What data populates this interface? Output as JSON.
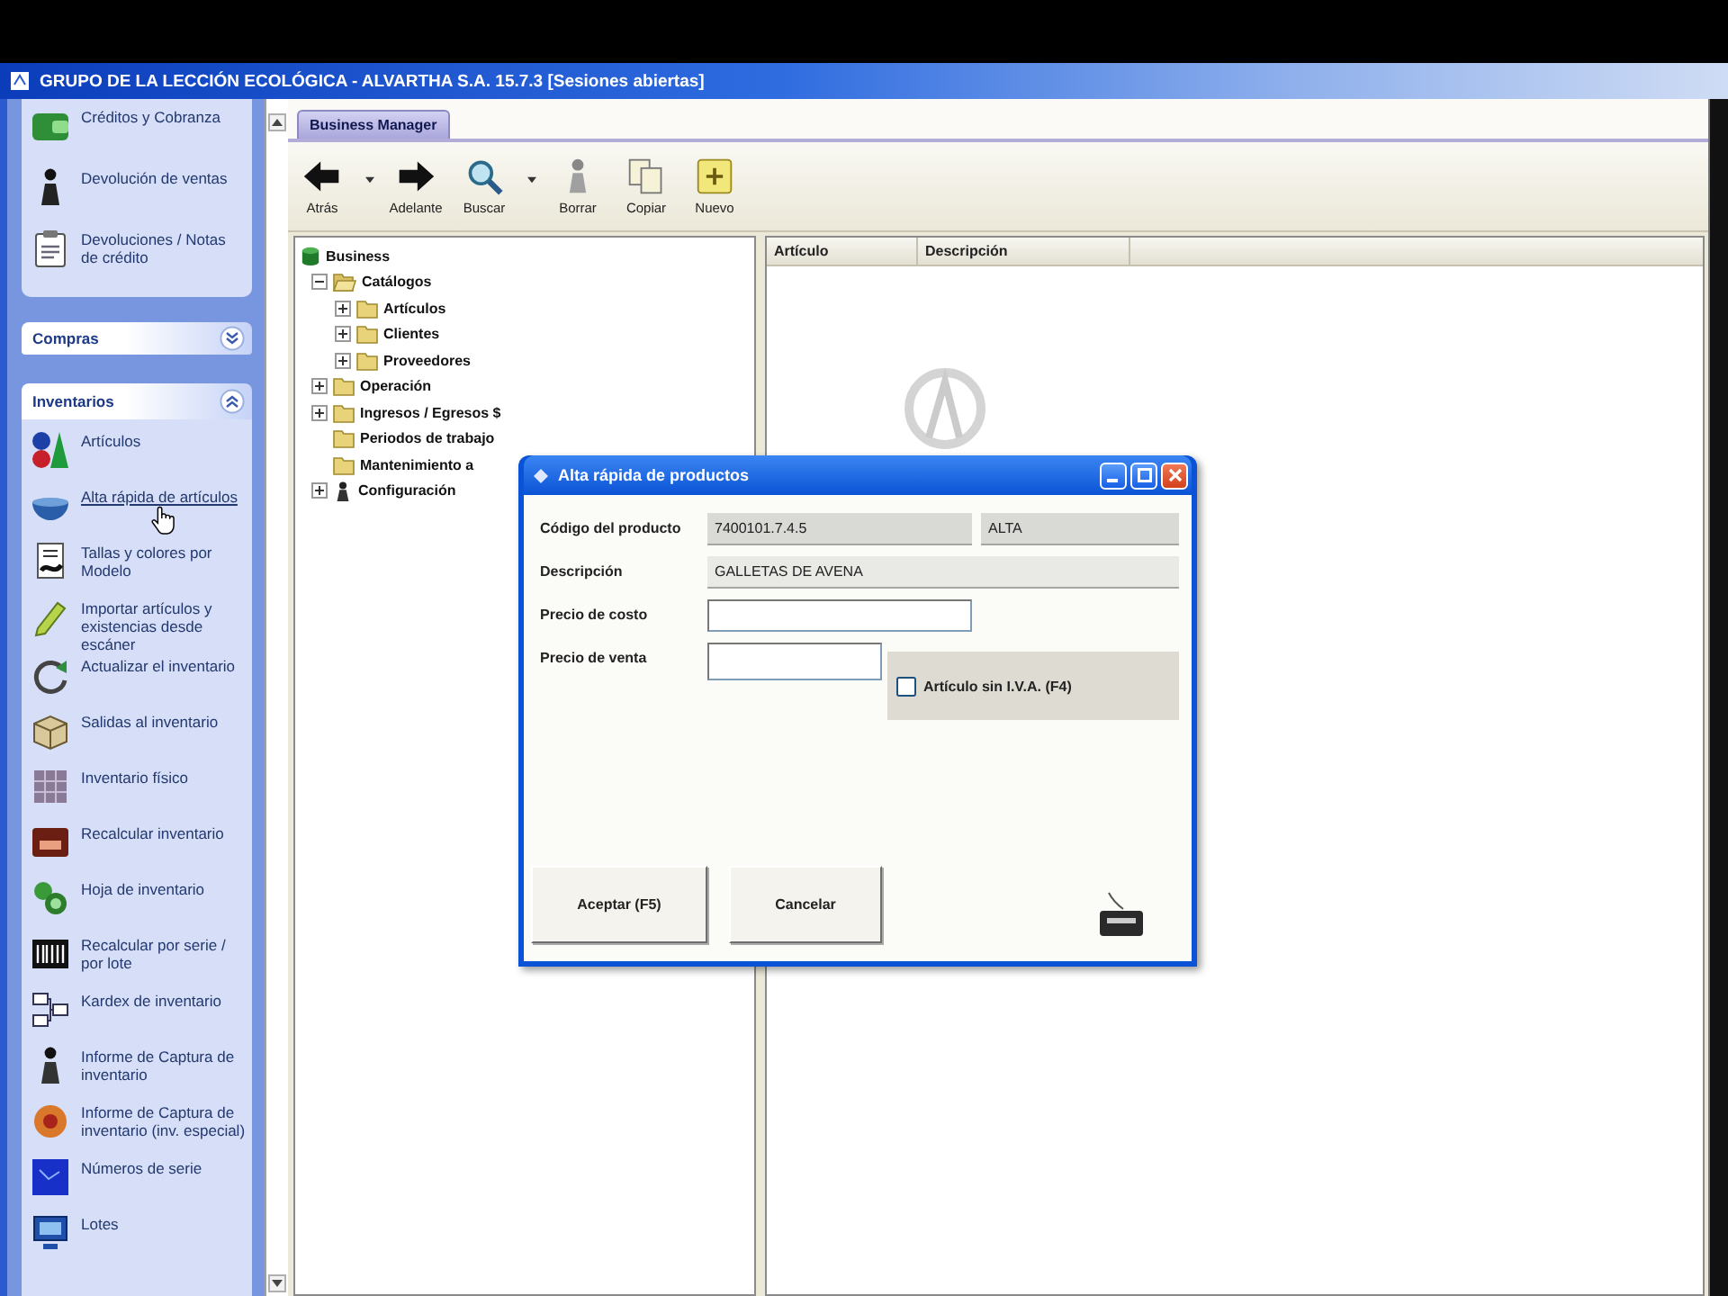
{
  "window": {
    "title": "GRUPO DE LA LECCIÓN ECOLÓGICA - ALVARTHA S.A. 15.7.3 [Sesiones abiertas]"
  },
  "sidebar": {
    "items": [
      {
        "label": "Créditos y Cobranza",
        "hovered": false
      },
      {
        "label": "Devolución de ventas",
        "hovered": false
      },
      {
        "label": "Devoluciones / Notas de crédito",
        "hovered": false
      }
    ],
    "groups": [
      {
        "title": "Compras",
        "expanded": false
      },
      {
        "title": "Inventarios",
        "expanded": true,
        "items": [
          {
            "label": "Artículos",
            "hovered": false
          },
          {
            "label": "Alta rápida de artículos",
            "hovered": true
          },
          {
            "label": "Tallas y colores por Modelo",
            "hovered": false
          },
          {
            "label": "Importar artículos y existencias desde escáner",
            "hovered": false
          },
          {
            "label": "Actualizar el inventario",
            "hovered": false
          },
          {
            "label": "Salidas al inventario",
            "hovered": false
          },
          {
            "label": "Inventario físico",
            "hovered": false
          },
          {
            "label": "Recalcular inventario",
            "hovered": false
          },
          {
            "label": "Hoja de inventario",
            "hovered": false
          },
          {
            "label": "Recalcular por serie / por lote",
            "hovered": false
          },
          {
            "label": "Kardex de inventario",
            "hovered": false
          },
          {
            "label": "Informe de Captura de inventario",
            "hovered": false
          },
          {
            "label": "Informe de Captura de inventario (inv. especial)",
            "hovered": false
          },
          {
            "label": "Números de serie",
            "hovered": false
          },
          {
            "label": "Lotes",
            "hovered": false
          }
        ]
      }
    ]
  },
  "tabs": [
    {
      "label": "Business Manager",
      "selected": true
    }
  ],
  "toolbar": [
    {
      "label": "Atrás",
      "dropdown": true
    },
    {
      "label": "Adelante",
      "dropdown": false
    },
    {
      "label": "Buscar",
      "dropdown": true
    },
    {
      "label": "Borrar",
      "dropdown": false
    },
    {
      "label": "Copiar",
      "dropdown": false
    },
    {
      "label": "Nuevo",
      "dropdown": false
    }
  ],
  "tree": [
    {
      "label": "Business",
      "kind": "root",
      "expandable": false,
      "expanded": true,
      "children": [
        {
          "label": "Catálogos",
          "kind": "folder",
          "expandable": true,
          "expanded": true,
          "children": [
            {
              "label": "Artículos",
              "kind": "folder",
              "expandable": true,
              "expanded": false
            },
            {
              "label": "Clientes",
              "kind": "folder",
              "expandable": true,
              "expanded": false
            },
            {
              "label": "Proveedores",
              "kind": "folder",
              "expandable": true,
              "expanded": false
            }
          ]
        },
        {
          "label": "Operación",
          "kind": "folder",
          "expandable": true,
          "expanded": false
        },
        {
          "label": "Ingresos / Egresos $",
          "kind": "folder",
          "expandable": true,
          "expanded": false
        },
        {
          "label": "Periodos de trabajo",
          "kind": "folder",
          "expandable": false,
          "expanded": false
        },
        {
          "label": "Mantenimiento a",
          "kind": "folder",
          "expandable": false,
          "expanded": false
        },
        {
          "label": "Configuración",
          "kind": "config",
          "expandable": true,
          "expanded": false
        }
      ]
    }
  ],
  "list": {
    "columns": [
      "Artículo",
      "Descripción"
    ]
  },
  "dialog": {
    "title": "Alta rápida de productos",
    "fields": [
      {
        "label": "Código del producto",
        "kind": "display",
        "value": "7400101.7.4.5",
        "status": "ALTA"
      },
      {
        "label": "Descripción",
        "kind": "display",
        "value": "GALLETAS DE AVENA"
      },
      {
        "label": "Precio de costo",
        "kind": "input"
      },
      {
        "label": "Precio de venta",
        "kind": "input"
      }
    ],
    "checkbox": {
      "label": "Artículo sin I.V.A. (F4)",
      "checked": false
    },
    "buttons": [
      "Aceptar (F5)",
      "Cancelar"
    ]
  }
}
